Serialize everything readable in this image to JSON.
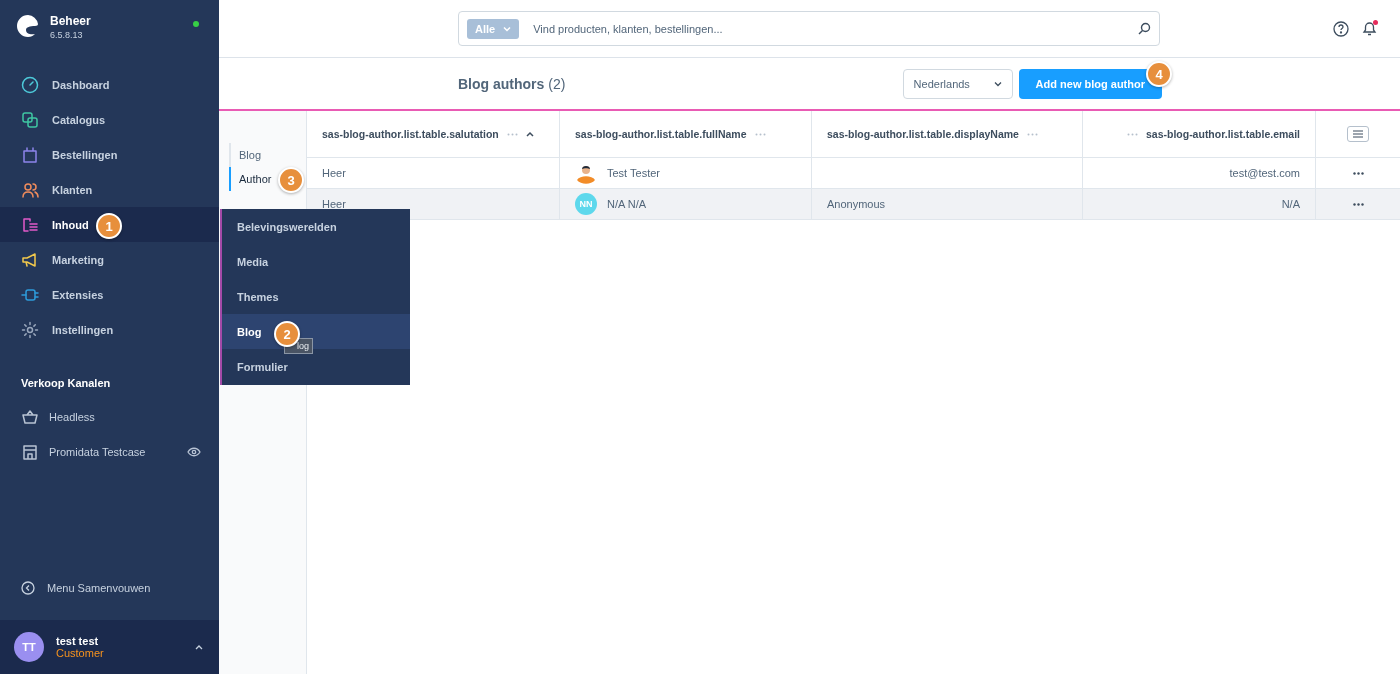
{
  "brand": {
    "title": "Beheer",
    "version": "6.5.8.13",
    "online": true
  },
  "nav": [
    {
      "label": "Dashboard",
      "selected": false
    },
    {
      "label": "Catalogus",
      "selected": false
    },
    {
      "label": "Bestellingen",
      "selected": false
    },
    {
      "label": "Klanten",
      "selected": false
    },
    {
      "label": "Inhoud",
      "selected": true
    },
    {
      "label": "Marketing",
      "selected": false
    },
    {
      "label": "Extensies",
      "selected": false
    },
    {
      "label": "Instellingen",
      "selected": false
    }
  ],
  "sales_channels": {
    "title": "Verkoop Kanalen",
    "items": [
      {
        "label": "Headless",
        "visible_toggle": false
      },
      {
        "label": "Promidata Testcase",
        "visible_toggle": true
      }
    ]
  },
  "collapse": "Menu Samenvouwen",
  "user": {
    "initials": "TT",
    "name": "test test",
    "role": "Customer"
  },
  "flyout": [
    {
      "label": "Belevingswerelden",
      "selected": false
    },
    {
      "label": "Media",
      "selected": false
    },
    {
      "label": "Themes",
      "selected": false
    },
    {
      "label": "Blog",
      "selected": true
    },
    {
      "label": "Formulier",
      "selected": false
    }
  ],
  "tooltip": "log",
  "search": {
    "filter": "Alle",
    "placeholder": "Vind producten, klanten, bestellingen..."
  },
  "notifications": {
    "unread": true
  },
  "page": {
    "title": "Blog authors",
    "count": "(2)",
    "language": "Nederlands",
    "add_button": "Add new blog author"
  },
  "subnav": [
    {
      "label": "Blog",
      "selected": false
    },
    {
      "label": "Author",
      "selected": true
    }
  ],
  "table": {
    "columns": [
      {
        "label": "sas-blog-author.list.table.salutation",
        "sorted": true
      },
      {
        "label": "sas-blog-author.list.table.fullName",
        "sorted": false
      },
      {
        "label": "sas-blog-author.list.table.displayName",
        "sorted": false
      },
      {
        "label": "sas-blog-author.list.table.email",
        "sorted": false
      }
    ],
    "rows": [
      {
        "salutation": "Heer",
        "full_name": "Test Tester",
        "display_name": "",
        "email": "test@test.com",
        "hovered": false
      },
      {
        "salutation": "Heer",
        "avatar": {
          "kind": "initials",
          "initials": "NN"
        },
        "full_name": "N/A N/A",
        "display_name": "Anonymous",
        "email": "N/A",
        "hovered": true
      }
    ]
  },
  "steps": [
    "1",
    "2",
    "3",
    "4"
  ]
}
